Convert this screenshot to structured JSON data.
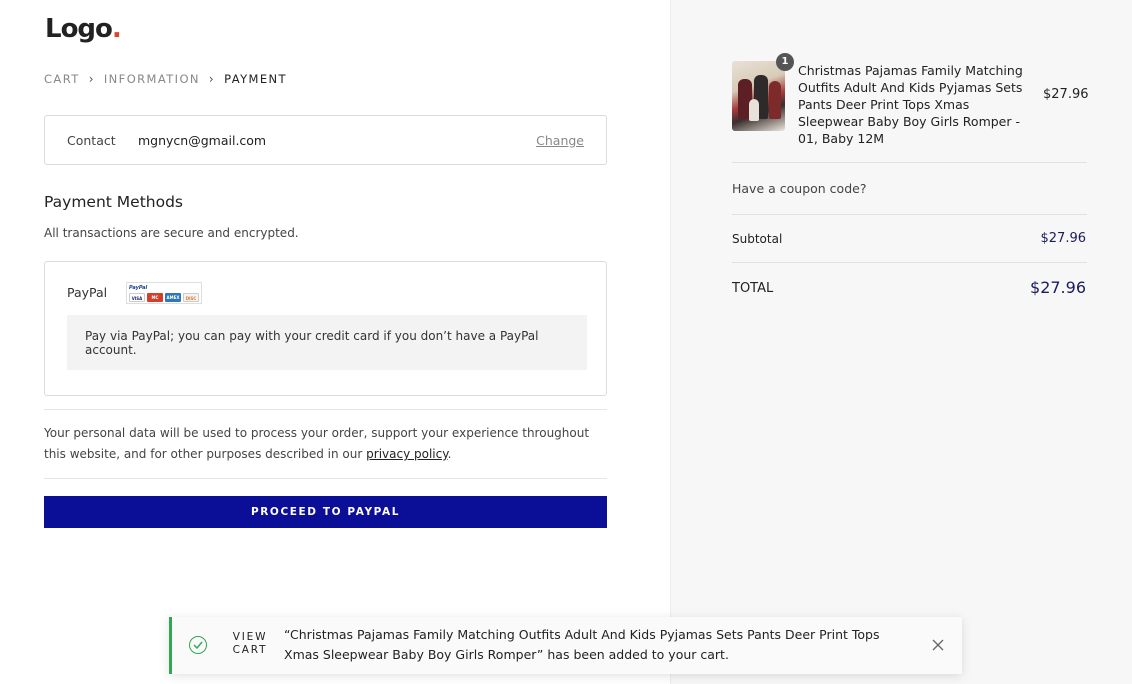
{
  "brand": {
    "logo_text": "Logo",
    "logo_dot": ".",
    "accent_color": "#e0452b",
    "button_color": "#0b0e96"
  },
  "breadcrumb": {
    "items": [
      "CART",
      "INFORMATION",
      "PAYMENT"
    ],
    "separator": "›"
  },
  "contact": {
    "label": "Contact",
    "value": "mgnycn@gmail.com",
    "change_label": "Change"
  },
  "payment": {
    "title": "Payment Methods",
    "subtitle": "All transactions are secure and encrypted.",
    "method_label": "PayPal",
    "method_info": "Pay via PayPal; you can pay with your credit card if you don’t have a PayPal account."
  },
  "privacy": {
    "text": "Your personal data will be used to process your order, support your experience throughout this website, and for other purposes described in our ",
    "link": "privacy policy",
    "suffix": "."
  },
  "proceed_button": "PROCEED TO PAYPAL",
  "order": {
    "item_qty": "1",
    "item_name": "Christmas Pajamas Family Matching Outfits Adult And Kids Pyjamas Sets Pants Deer Print Tops Xmas Sleepwear Baby Boy Girls Romper - 01, Baby 12M",
    "item_price": "$27.96",
    "coupon_prompt": "Have a coupon code?",
    "subtotal_label": "Subtotal",
    "subtotal_value": "$27.96",
    "total_label": "TOTAL",
    "total_value": "$27.96"
  },
  "notification": {
    "view_cart_line1": "VIEW",
    "view_cart_line2": "CART",
    "message": "“Christmas Pajamas Family Matching Outfits Adult And Kids Pyjamas Sets Pants Deer Print Tops Xmas Sleepwear Baby Boy Girls Romper” has been added to your cart.",
    "status_color": "#2fa84f"
  }
}
